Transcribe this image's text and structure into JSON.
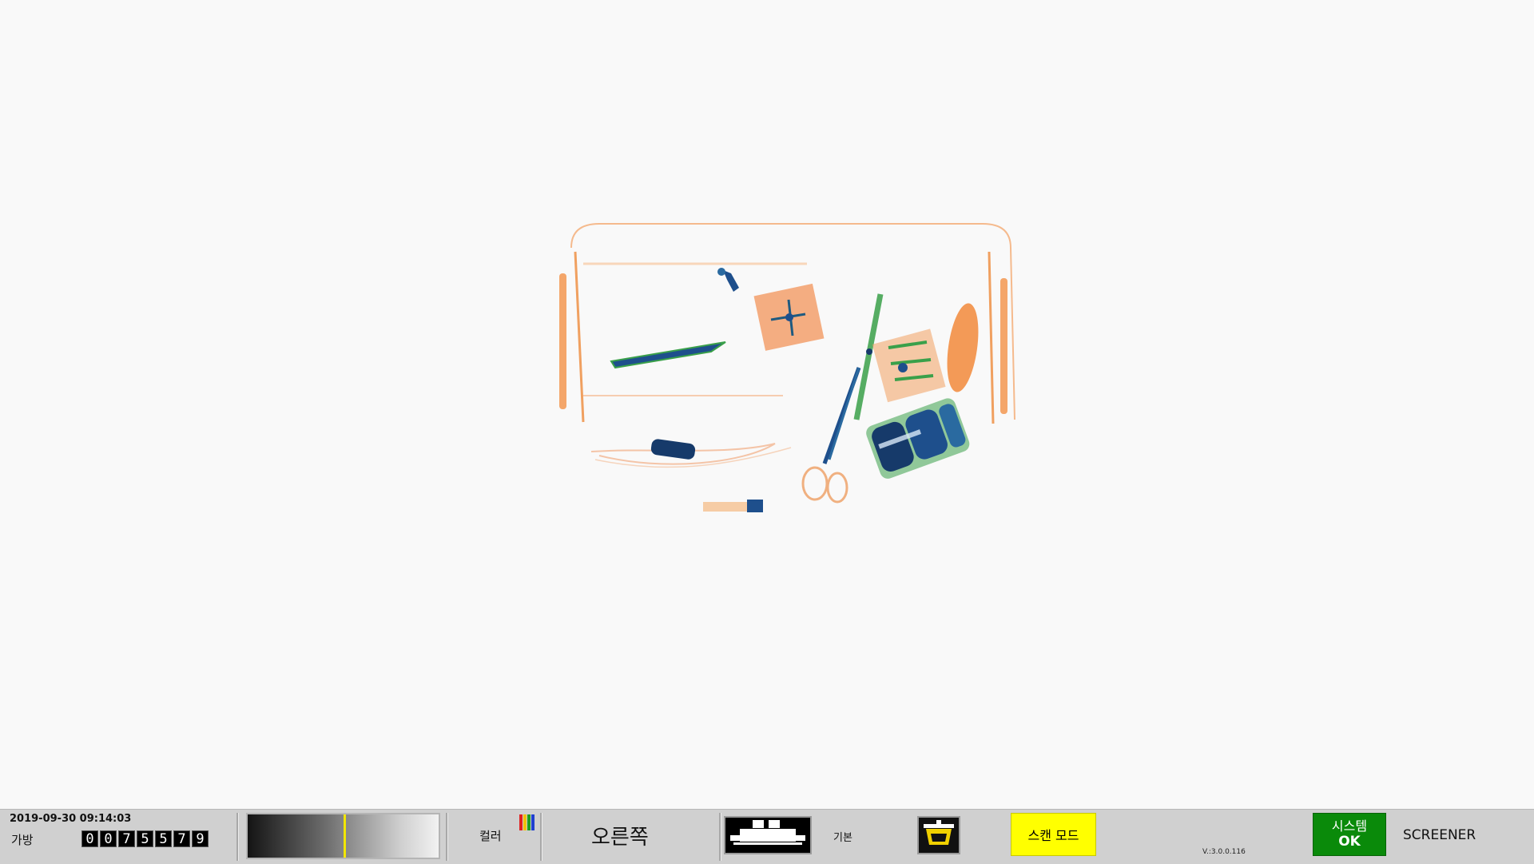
{
  "status_bar": {
    "datetime": "2019-09-30 09:14:03",
    "bag_label": "가방",
    "bag_counter": [
      "0",
      "0",
      "7",
      "5",
      "5",
      "7",
      "9"
    ],
    "gradient_marker_position": 0.5,
    "color_label": "컬러",
    "color_icon_colors": [
      "#e02020",
      "#f0c000",
      "#20a020",
      "#2040d0"
    ],
    "direction": "오른쪽",
    "conveyor_icon": "conveyor-belt-icon",
    "basic_label": "기본",
    "bin_icon": "tray-bin-icon",
    "scan_mode_label": "스캔 모드",
    "scan_mode_color": "#ffff00",
    "version": "V.:3.0.0.116",
    "system_line1": "시스템",
    "system_line2": "OK",
    "system_color": "#0a8a0a",
    "role": "SCREENER"
  },
  "xray_image": {
    "contents": [
      "suitcase",
      "knife",
      "scissors",
      "battery-packs",
      "circuit-board",
      "cables"
    ],
    "palette": {
      "organic": "#f08030",
      "inorganic": "#3aa04a",
      "metal": "#1e4f8c"
    }
  }
}
